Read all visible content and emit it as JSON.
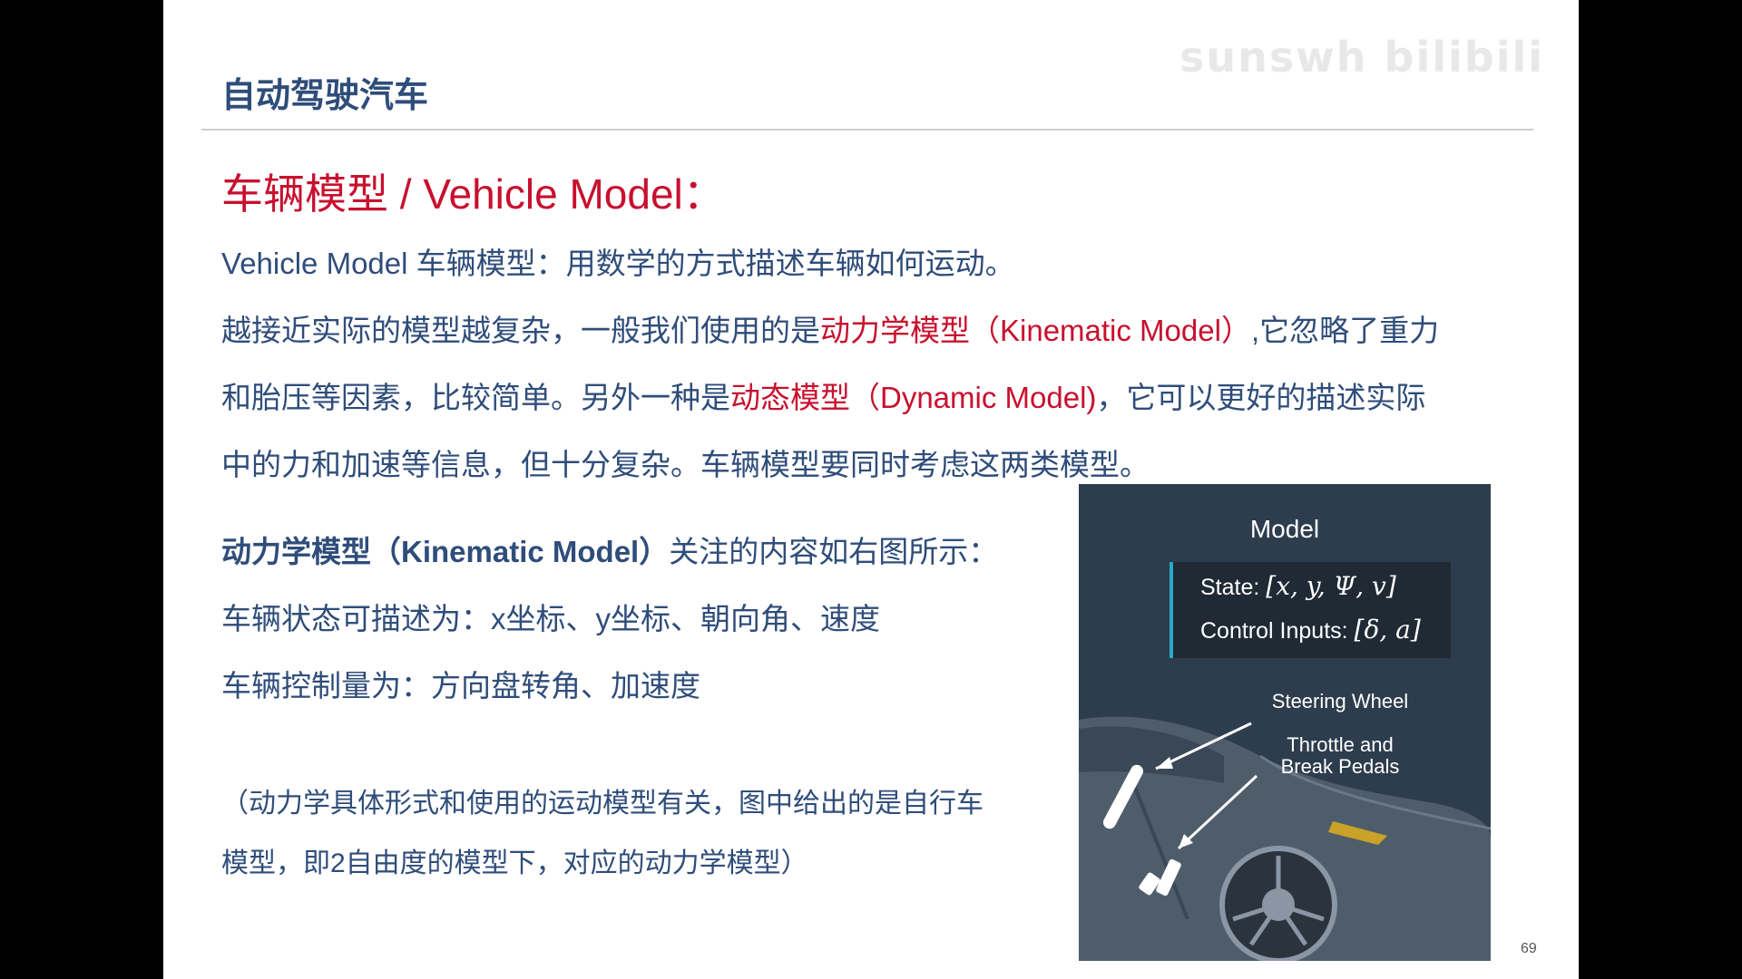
{
  "header": {
    "title": "自动驾驶汽车",
    "watermark": "sunswh bilibili"
  },
  "section": {
    "title": "车辆模型 / Vehicle Model："
  },
  "body": {
    "line1": "Vehicle Model 车辆模型：用数学的方式描述车辆如何运动。",
    "line2_a": "越接近实际的模型越复杂，一般我们使用的是",
    "line2_red": "动力学模型（Kinematic Model）",
    "line2_b": ",它忽略了重力",
    "line3_a": "和胎压等因素，比较简单。另外一种是",
    "line3_red": "动态模型（Dynamic Model)",
    "line3_b": "，它可以更好的描述实际",
    "line4": "中的力和加速等信息，但十分复杂。车辆模型要同时考虑这两类模型。",
    "kin_bold": "动力学模型（Kinematic Model）",
    "kin_rest": "关注的内容如右图所示：",
    "state_line": "车辆状态可描述为：x坐标、y坐标、朝向角、速度",
    "control_line": "车辆控制量为：方向盘转角、加速度",
    "note_line1": "（动力学具体形式和使用的运动模型有关，图中给出的是自行车",
    "note_line2": "模型，即2自由度的模型下，对应的动力学模型）"
  },
  "figure": {
    "title": "Model",
    "state_label": "State:",
    "state_math": "[x, y, Ψ, v]",
    "control_label": "Control Inputs:",
    "control_math": "[δ, a]",
    "steering_label": "Steering Wheel",
    "pedals_label_1": "Throttle and",
    "pedals_label_2": "Break Pedals"
  },
  "footer": {
    "page_number": "69"
  },
  "colors": {
    "heading_blue": "#2f4d7a",
    "accent_red": "#c8102e",
    "figure_bg": "#2e3d4d",
    "figure_accent": "#29a9c4"
  }
}
